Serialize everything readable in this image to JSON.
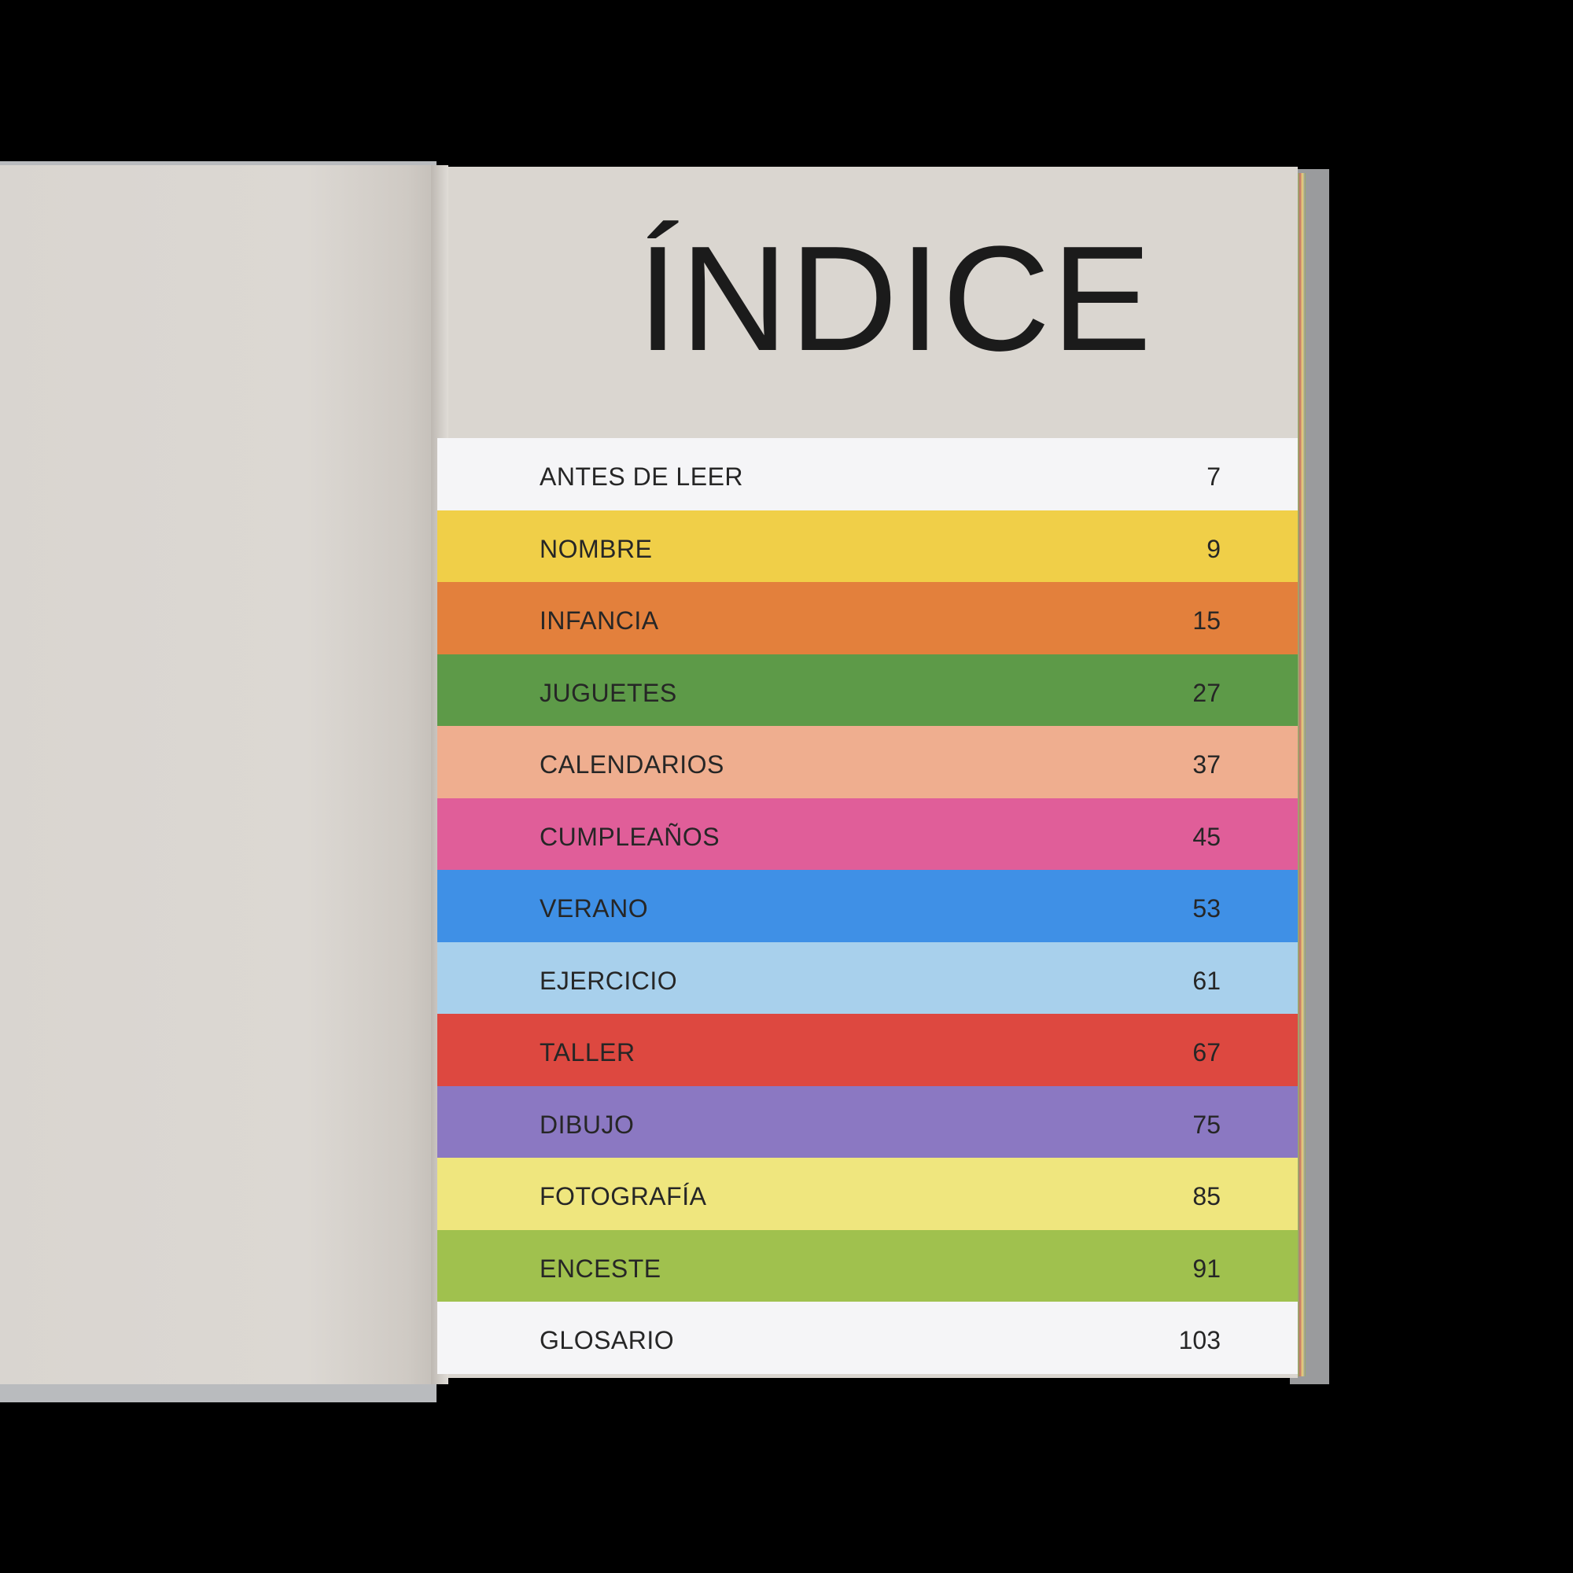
{
  "title": "ÍNDICE",
  "entries": [
    {
      "label": "ANTES DE LEER",
      "page": "7",
      "color": "#f5f5f7"
    },
    {
      "label": "NOMBRE",
      "page": "9",
      "color": "#f0cf48"
    },
    {
      "label": "INFANCIA",
      "page": "15",
      "color": "#e3803c"
    },
    {
      "label": "JUGUETES",
      "page": "27",
      "color": "#5d9a48"
    },
    {
      "label": "CALENDARIOS",
      "page": "37",
      "color": "#efae8f"
    },
    {
      "label": "CUMPLEAÑOS",
      "page": "45",
      "color": "#e05e99"
    },
    {
      "label": "VERANO",
      "page": "53",
      "color": "#3f90e6"
    },
    {
      "label": "EJERCICIO",
      "page": "61",
      "color": "#a8d0ec"
    },
    {
      "label": "TALLER",
      "page": "67",
      "color": "#dd4840"
    },
    {
      "label": "DIBUJO",
      "page": "75",
      "color": "#8b78c2"
    },
    {
      "label": "FOTOGRAFÍA",
      "page": "85",
      "color": "#efe67e"
    },
    {
      "label": "ENCESTE",
      "page": "91",
      "color": "#a0c14e"
    },
    {
      "label": "GLOSARIO",
      "page": "103",
      "color": "#f5f5f7"
    }
  ]
}
